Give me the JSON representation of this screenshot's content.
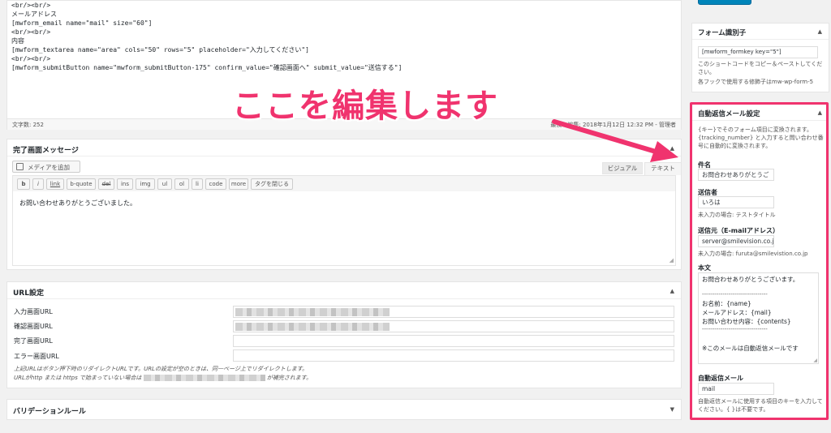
{
  "editor": {
    "code_lines": [
      "<br/><br/>",
      "メールアドレス",
      "[mwform_email name=\"mail\" size=\"60\"]",
      "<br/><br/>",
      "内容",
      "[mwform_textarea name=\"area\" cols=\"50\" rows=\"5\" placeholder=\"入力してください\"]",
      "<br/><br/>",
      "[mwform_submitButton name=\"mwform_submitButton-175\" confirm_value=\"確認画面へ\" submit_value=\"送信する\"]"
    ],
    "char_count": "文字数: 252",
    "last_edit": "最後の編集: 2018年1月12日 12:32 PM - 管理者"
  },
  "overlay": {
    "text": "ここを編集します",
    "color": "#f0336e"
  },
  "complete_message": {
    "title": "完了画面メッセージ",
    "media_button": "メディアを追加",
    "tab_visual": "ビジュアル",
    "tab_text": "テキスト",
    "quicktags": [
      "b",
      "i",
      "link",
      "b-quote",
      "del",
      "ins",
      "img",
      "ul",
      "ol",
      "li",
      "code",
      "more",
      "タグを閉じる"
    ],
    "content": "お問い合わせありがとうございました。"
  },
  "url_settings": {
    "title": "URL設定",
    "rows": [
      {
        "label": "入力画面URL"
      },
      {
        "label": "確認画面URL"
      },
      {
        "label": "完了画面URL"
      },
      {
        "label": "エラー画面URL"
      }
    ],
    "note1": "上記URLはボタン押下時のリダイレクトURLです。URLの設定が空のときは、同一ページ上でリダイレクトします。",
    "note2_a": "URLがhttp または https で始まっていない場合は",
    "note2_b": "が補完されます。"
  },
  "validation": {
    "title": "バリデーションルール"
  },
  "form_key": {
    "title": "フォーム識別子",
    "value": "[mwform_formkey key=\"5\"]",
    "desc1": "このショートコードをコピー＆ペーストしてください。",
    "desc2": "各フックで使用する修飾子はmw-wp-form-5"
  },
  "auto_reply": {
    "title": "自動返信メール設定",
    "intro": "{キー}でそのフォーム項目に変換されます。 {tracking_number} と入力すると問い合わせ番号に自動的に変換されます。",
    "subject_label": "件名",
    "subject_value": "お問合わせありがとうご",
    "sender_label": "送信者",
    "sender_value": "いろは",
    "sender_note": "未入力の場合: テストタイトル",
    "from_label": "送信元（E-mailアドレス）",
    "from_value": "server@smilevision.co.j",
    "from_note": "未入力の場合: furuta@smilevistion.co.jp",
    "body_label": "本文",
    "body_lines": [
      "お問合わせありがとうございます。",
      "",
      "--------------------------------",
      "お名前：{name}",
      "メールアドレス：{mail}",
      "お問い合わせ内容：{contents}",
      "--------------------------------",
      "",
      "※このメールは自動返信メールです"
    ],
    "auto_mail_label": "自動返信メール",
    "auto_mail_value": "mail",
    "auto_mail_note": "自動返信メールに使用する項目のキーを入力してください。{ }は不要です。"
  },
  "icons": {
    "toggle": "triangle-up-icon",
    "media": "camera-music-icon"
  }
}
